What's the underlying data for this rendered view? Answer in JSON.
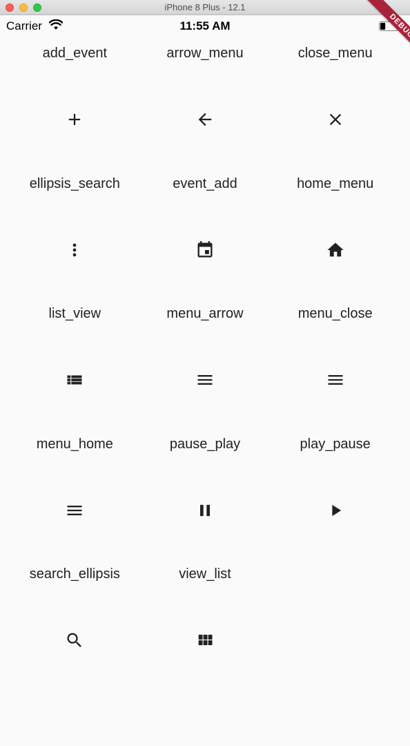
{
  "window": {
    "title": "iPhone 8 Plus - 12.1"
  },
  "status_bar": {
    "carrier": "Carrier",
    "time": "11:55 AM",
    "battery_level": 0.3
  },
  "debug_banner": {
    "label": "DEBUG",
    "color": "#a8243b"
  },
  "items": [
    {
      "label": "add_event",
      "icon": "add-icon"
    },
    {
      "label": "arrow_menu",
      "icon": "arrow-back-icon"
    },
    {
      "label": "close_menu",
      "icon": "close-icon"
    },
    {
      "label": "ellipsis_search",
      "icon": "more-vert-icon"
    },
    {
      "label": "event_add",
      "icon": "calendar-event-icon"
    },
    {
      "label": "home_menu",
      "icon": "home-icon"
    },
    {
      "label": "list_view",
      "icon": "view-list-icon"
    },
    {
      "label": "menu_arrow",
      "icon": "menu-icon"
    },
    {
      "label": "menu_close",
      "icon": "menu-icon"
    },
    {
      "label": "menu_home",
      "icon": "menu-icon"
    },
    {
      "label": "pause_play",
      "icon": "pause-icon"
    },
    {
      "label": "play_pause",
      "icon": "play-icon"
    },
    {
      "label": "search_ellipsis",
      "icon": "search-icon"
    },
    {
      "label": "view_list",
      "icon": "view-module-icon"
    }
  ]
}
